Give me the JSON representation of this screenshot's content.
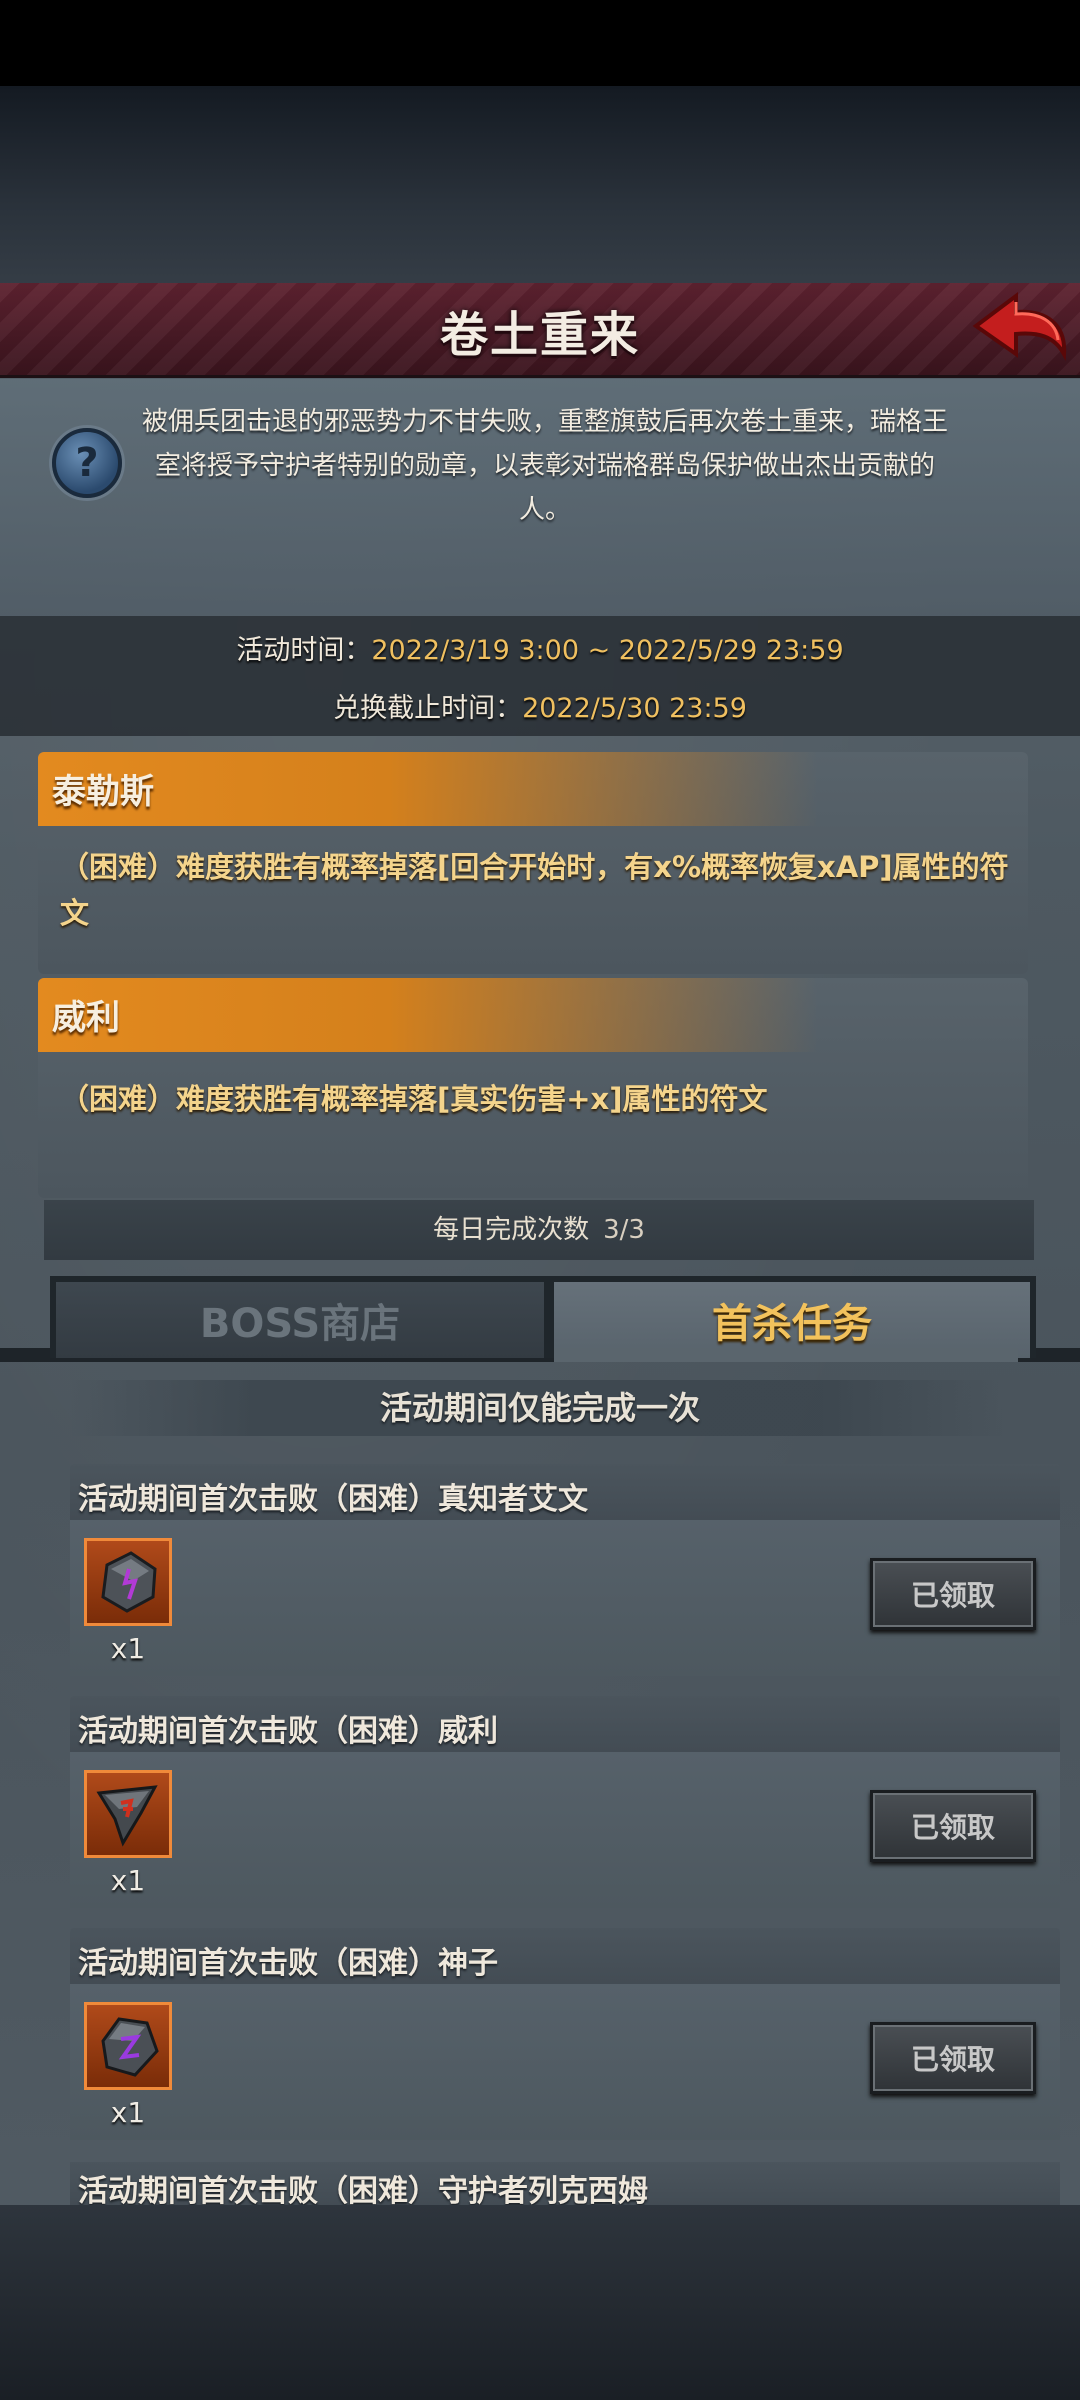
{
  "header": {
    "title": "卷土重来"
  },
  "intro": {
    "text": "被佣兵团击退的邪恶势力不甘失败，重整旗鼓后再次卷土重来，瑞格王室将授予守护者特别的勋章，以表彰对瑞格群岛保护做出杰出贡献的人。",
    "help_glyph": "?"
  },
  "event_time": {
    "label": "活动时间：",
    "value": "2022/3/19 3:00 ~ 2022/5/29 23:59",
    "exchange_label": "兑换截止时间：",
    "exchange_value": "2022/5/30 23:59"
  },
  "bosses": [
    {
      "name": "泰勒斯",
      "desc": "（困难）难度获胜有概率掉落[回合开始时，有x%概率恢复xAP]属性的符文"
    },
    {
      "name": "威利",
      "desc": "（困难）难度获胜有概率掉落[真实伤害+x]属性的符文"
    }
  ],
  "daily": {
    "label": "每日完成次数",
    "value": "3/3"
  },
  "tabs": [
    {
      "label": "BOSS商店",
      "active": false
    },
    {
      "label": "首杀任务",
      "active": true
    }
  ],
  "once_label": "活动期间仅能完成一次",
  "tasks": [
    {
      "title": "活动期间首次击败（困难）真知者艾文",
      "qty": "x1",
      "button": "已领取",
      "rune_color": "#b23ad6"
    },
    {
      "title": "活动期间首次击败（困难）威利",
      "qty": "x1",
      "button": "已领取",
      "rune_color": "#d0301e"
    },
    {
      "title": "活动期间首次击败（困难）神子",
      "qty": "x1",
      "button": "已领取",
      "rune_color": "#9a3ae0"
    }
  ],
  "partial_task": {
    "title": "活动期间首次击败（困难）守护者列克西姆"
  },
  "colors": {
    "accent_orange": "#e38a1f",
    "gold_text": "#f0c060",
    "header_red": "#5e2230"
  }
}
